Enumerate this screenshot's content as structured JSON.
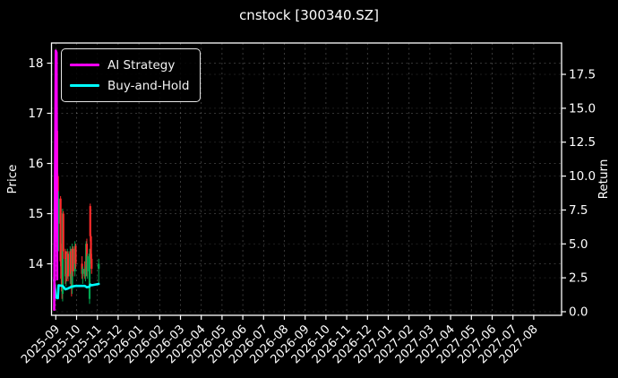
{
  "figure": {
    "title": "cnstock [300340.SZ]"
  },
  "chart_data": {
    "type": "candlestick",
    "title": "cnstock [300340.SZ]",
    "background": "#000000",
    "grid": true,
    "legend_position": "upper left",
    "price_axis": {
      "label": "Price",
      "ticks": [
        14,
        15,
        16,
        17,
        18
      ],
      "range": [
        12.95,
        18.45
      ]
    },
    "return_axis": {
      "label": "Return",
      "ticks": [
        0.0,
        2.5,
        5.0,
        7.5,
        10.0,
        12.5,
        15.0,
        17.5
      ],
      "range": [
        -0.3,
        19.8
      ]
    },
    "x_axis": {
      "tick_labels": [
        "2025-09",
        "2025-10",
        "2025-11",
        "2025-12",
        "2026-01",
        "2026-02",
        "2026-03",
        "2026-04",
        "2026-05",
        "2026-06",
        "2026-07",
        "2026-08",
        "2026-09",
        "2026-10",
        "2026-11",
        "2026-12",
        "2027-01",
        "2027-02",
        "2027-03",
        "2027-04",
        "2027-05",
        "2027-06",
        "2027-07",
        "2027-08"
      ],
      "rotation": 45
    },
    "colors": {
      "up": "#00a651",
      "down": "#ff2b2b",
      "ai": "#ff00ff",
      "buy_hold": "#00ffff",
      "fg": "#ffffff",
      "grid": "#8a8a8a"
    },
    "candles": [
      {
        "d": "2025-09-01",
        "o": 18.05,
        "h": 18.19,
        "l": 17.4,
        "c": 17.55
      },
      {
        "d": "2025-09-02",
        "o": 17.55,
        "h": 17.6,
        "l": 16.55,
        "c": 16.65
      },
      {
        "d": "2025-09-03",
        "o": 16.65,
        "h": 16.7,
        "l": 15.65,
        "c": 15.75
      },
      {
        "d": "2025-09-04",
        "o": 15.75,
        "h": 15.8,
        "l": 14.7,
        "c": 14.8
      },
      {
        "d": "2025-09-05",
        "o": 14.8,
        "h": 15.45,
        "l": 14.25,
        "c": 15.3
      },
      {
        "d": "2025-09-08",
        "o": 15.3,
        "h": 15.35,
        "l": 13.95,
        "c": 14.05
      },
      {
        "d": "2025-09-09",
        "o": 14.05,
        "h": 14.4,
        "l": 13.55,
        "c": 13.7
      },
      {
        "d": "2025-09-10",
        "o": 13.7,
        "h": 13.8,
        "l": 13.3,
        "c": 13.45
      },
      {
        "d": "2025-09-11",
        "o": 13.4,
        "h": 15.1,
        "l": 13.25,
        "c": 15.0
      },
      {
        "d": "2025-09-12",
        "o": 15.0,
        "h": 15.05,
        "l": 14.1,
        "c": 14.25
      },
      {
        "d": "2025-09-15",
        "o": 14.25,
        "h": 14.3,
        "l": 13.6,
        "c": 13.75
      },
      {
        "d": "2025-09-16",
        "o": 13.75,
        "h": 14.1,
        "l": 13.55,
        "c": 14.05
      },
      {
        "d": "2025-09-17",
        "o": 14.05,
        "h": 14.25,
        "l": 13.65,
        "c": 13.8
      },
      {
        "d": "2025-09-18",
        "o": 13.8,
        "h": 14.3,
        "l": 13.7,
        "c": 14.2
      },
      {
        "d": "2025-09-19",
        "o": 14.2,
        "h": 14.25,
        "l": 13.65,
        "c": 13.75
      },
      {
        "d": "2025-09-22",
        "o": 13.75,
        "h": 14.35,
        "l": 13.6,
        "c": 14.25
      },
      {
        "d": "2025-09-23",
        "o": 14.25,
        "h": 14.3,
        "l": 13.7,
        "c": 13.8
      },
      {
        "d": "2025-09-24",
        "o": 13.8,
        "h": 14.1,
        "l": 13.35,
        "c": 13.5
      },
      {
        "d": "2025-09-25",
        "o": 13.5,
        "h": 14.4,
        "l": 13.4,
        "c": 14.3
      },
      {
        "d": "2025-09-26",
        "o": 14.3,
        "h": 14.35,
        "l": 13.75,
        "c": 13.85
      },
      {
        "d": "2025-09-29",
        "o": 13.85,
        "h": 14.45,
        "l": 13.75,
        "c": 14.35
      },
      {
        "d": "2025-09-30",
        "o": 14.35,
        "h": 14.4,
        "l": 13.9,
        "c": 14.0
      },
      {
        "d": "2025-10-09",
        "o": 14.0,
        "h": 14.15,
        "l": 13.7,
        "c": 13.8
      },
      {
        "d": "2025-10-10",
        "o": 13.8,
        "h": 13.95,
        "l": 13.6,
        "c": 13.9
      },
      {
        "d": "2025-10-13",
        "o": 13.9,
        "h": 14.05,
        "l": 13.7,
        "c": 13.75
      },
      {
        "d": "2025-10-14",
        "o": 13.75,
        "h": 13.95,
        "l": 13.65,
        "c": 13.9
      },
      {
        "d": "2025-10-15",
        "o": 13.9,
        "h": 14.45,
        "l": 13.85,
        "c": 14.4
      },
      {
        "d": "2025-10-16",
        "o": 14.4,
        "h": 14.5,
        "l": 13.75,
        "c": 13.85
      },
      {
        "d": "2025-10-17",
        "o": 13.85,
        "h": 14.2,
        "l": 13.7,
        "c": 14.15
      },
      {
        "d": "2025-10-20",
        "o": 13.3,
        "h": 14.3,
        "l": 13.2,
        "c": 14.2
      },
      {
        "d": "2025-10-21",
        "o": 15.15,
        "h": 15.2,
        "l": 14.45,
        "c": 14.55
      },
      {
        "d": "2025-10-22",
        "o": 14.55,
        "h": 14.6,
        "l": 14.0,
        "c": 14.1
      },
      {
        "d": "2025-10-23",
        "o": 14.1,
        "h": 14.2,
        "l": 13.8,
        "c": 13.9
      },
      {
        "d": "2025-11-03",
        "o": 13.9,
        "h": 14.1,
        "l": 13.6,
        "c": 14.0
      }
    ],
    "series": [
      {
        "name": "AI Strategy",
        "color": "#ff00ff",
        "axis": "return",
        "points": [
          [
            "2025-08-29",
            0.15
          ],
          [
            "2025-09-01",
            19.25
          ],
          [
            "2025-09-02",
            19.1
          ],
          [
            "2025-09-03",
            2.4
          ]
        ]
      },
      {
        "name": "Buy-and-Hold",
        "color": "#00ffff",
        "axis": "return",
        "points": [
          [
            "2025-08-29",
            2.35
          ],
          [
            "2025-09-01",
            1.05
          ],
          [
            "2025-09-04",
            1.0
          ],
          [
            "2025-09-05",
            1.95
          ],
          [
            "2025-09-11",
            1.9
          ],
          [
            "2025-09-15",
            1.65
          ],
          [
            "2025-09-18",
            1.7
          ],
          [
            "2025-09-24",
            1.85
          ],
          [
            "2025-09-30",
            1.9
          ],
          [
            "2025-10-13",
            1.9
          ],
          [
            "2025-10-16",
            1.8
          ],
          [
            "2025-10-20",
            1.85
          ],
          [
            "2025-10-21",
            2.0
          ],
          [
            "2025-10-23",
            1.95
          ],
          [
            "2025-11-03",
            2.05
          ]
        ]
      }
    ]
  }
}
